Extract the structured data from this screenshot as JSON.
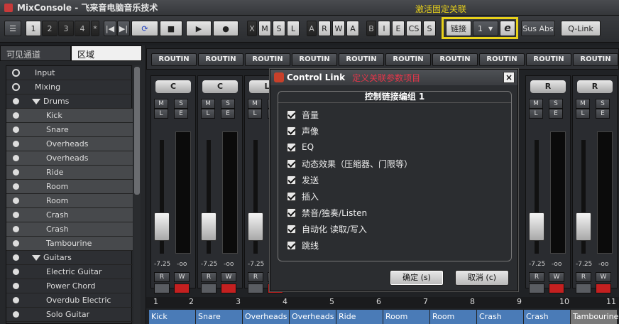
{
  "window": {
    "title": "MixConsole - 飞来音电脑音乐技术"
  },
  "toolbar": {
    "pages": [
      "1",
      "2",
      "3",
      "4",
      "*"
    ],
    "transport": [
      "|◀",
      "▶|",
      "⟳",
      "■",
      "▶",
      "●"
    ],
    "filters_a": [
      "X",
      "M",
      "S",
      "L"
    ],
    "filters_b": [
      "A",
      "R",
      "W",
      "A"
    ],
    "filters_c": [
      "B",
      "I",
      "E",
      "CS",
      "S"
    ],
    "link_label": "链接",
    "link_group": "1",
    "e_label": "e",
    "sus_abs": "Sus Abs",
    "qlink": "Q-Link",
    "annotation": "激活固定关联"
  },
  "left": {
    "tabs": [
      "可见通道",
      "区域"
    ],
    "channels": [
      {
        "name": "Input",
        "type": "circle"
      },
      {
        "name": "Mixing",
        "type": "circle"
      },
      {
        "name": "Drums",
        "type": "folder"
      },
      {
        "name": "Kick",
        "type": "sub"
      },
      {
        "name": "Snare",
        "type": "sub"
      },
      {
        "name": "Overheads",
        "type": "sub"
      },
      {
        "name": "Overheads",
        "type": "sub"
      },
      {
        "name": "Ride",
        "type": "sub"
      },
      {
        "name": "Room",
        "type": "sub"
      },
      {
        "name": "Room",
        "type": "sub"
      },
      {
        "name": "Crash",
        "type": "sub"
      },
      {
        "name": "Crash",
        "type": "sub"
      },
      {
        "name": "Tambourine",
        "type": "sub"
      },
      {
        "name": "Guitars",
        "type": "folder"
      },
      {
        "name": "Electric Guitar",
        "type": "sub2"
      },
      {
        "name": "Power Chord",
        "type": "sub2"
      },
      {
        "name": "Overdub Electric",
        "type": "sub2"
      },
      {
        "name": "Solo Guitar",
        "type": "sub2"
      }
    ]
  },
  "mixer": {
    "routing_label": "ROUTIN",
    "strips": [
      {
        "pan": "C",
        "num": "1",
        "num2": "2",
        "name": "Kick",
        "level": "-7.25",
        "oo": "-oo"
      },
      {
        "pan": "C",
        "num": "",
        "num2": "3",
        "name": "Snare",
        "level": "-7.25",
        "oo": "-oo"
      },
      {
        "pan": "L",
        "num": "",
        "num2": "4",
        "name": "Overheads",
        "level": "-7.25",
        "oo": "-oo"
      },
      {
        "pan": "",
        "num": "",
        "num2": "5",
        "name": "Overheads",
        "level": "",
        "oo": ""
      },
      {
        "pan": "",
        "num": "",
        "num2": "6",
        "name": "Ride",
        "level": "",
        "oo": ""
      },
      {
        "pan": "",
        "num": "",
        "num2": "7",
        "name": "Room",
        "level": "",
        "oo": ""
      },
      {
        "pan": "",
        "num": "",
        "num2": "8",
        "name": "Room",
        "level": "",
        "oo": ""
      },
      {
        "pan": "",
        "num": "",
        "num2": "9",
        "name": "Crash",
        "level": "",
        "oo": ""
      },
      {
        "pan": "R",
        "num": "",
        "num2": "10",
        "name": "Crash",
        "level": "-7.25",
        "oo": "-oo"
      },
      {
        "pan": "R",
        "num": "",
        "num2": "11",
        "name": "Tambourine",
        "level": "-7.25",
        "oo": "-oo"
      }
    ],
    "msle": [
      "M",
      "S",
      "L",
      "E"
    ],
    "rw": [
      "R",
      "W"
    ]
  },
  "dialog": {
    "title": "Control Link",
    "annotation": "定义关联参数项目",
    "close": "×",
    "group_title": "控制链接编组 1",
    "items": [
      "音量",
      "声像",
      "EQ",
      "动态效果（压缩器、门限等）",
      "发送",
      "插入",
      "禁音/独奏/Listen",
      "自动化 读取/写入",
      "跳线"
    ],
    "ok": "确定 (s)",
    "cancel": "取消 (c)"
  }
}
